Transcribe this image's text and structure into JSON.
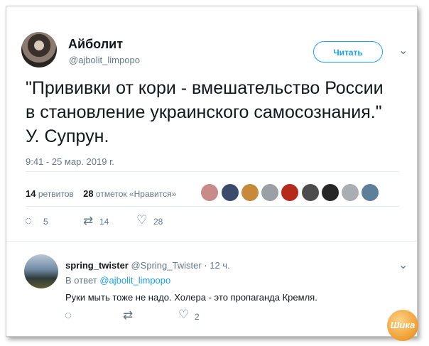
{
  "tweet": {
    "author_name": "Айболит",
    "author_handle": "@ajbolit_limpopo",
    "follow_label": "Читать",
    "text_lines": [
      "\"Прививки от кори - вмешательство России",
      "в становление украинского самосознания.\"",
      "У. Супрун."
    ],
    "timestamp": "9:41 - 25 мар. 2019 г.",
    "retweets_count": "14",
    "retweets_label": "ретвитов",
    "likes_count": "28",
    "likes_label": "отметок «Нравится»",
    "actions": {
      "replies": "5",
      "retweets": "14",
      "likes": "28"
    }
  },
  "likers": [
    {
      "icon": "avatar",
      "color": "#c98a8a"
    },
    {
      "icon": "avatar",
      "color": "#3c4a6b"
    },
    {
      "icon": "avatar",
      "color": "#c7893a"
    },
    {
      "icon": "avatar",
      "color": "#9aa0a6"
    },
    {
      "icon": "avatar",
      "color": "#b52a1c"
    },
    {
      "icon": "avatar",
      "color": "#4d4d4d"
    },
    {
      "icon": "avatar",
      "color": "#262626"
    },
    {
      "icon": "avatar",
      "color": "#a9aeb3"
    },
    {
      "icon": "avatar",
      "color": "#5e7f9a"
    }
  ],
  "reply": {
    "author_name": "spring_twister",
    "author_handle": "@Spring_Twister",
    "time": "· 12 ч.",
    "in_reply_prefix": "В ответ",
    "in_reply_handle": "@ajbolit_limpopo",
    "text": "Руки мыть тоже не надо. Холера - это пропаганда Кремля.",
    "actions": {
      "replies": "",
      "retweets": "",
      "likes": "2"
    }
  },
  "watermark": {
    "text": "Шика"
  },
  "colors": {
    "accent": "#1da1f2",
    "text": "#14171a",
    "secondary": "#657786"
  }
}
